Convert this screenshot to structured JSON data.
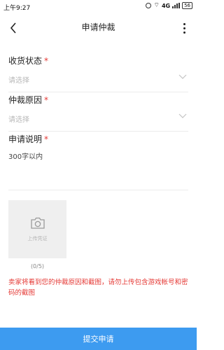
{
  "status_bar": {
    "time": "上午9:27",
    "network": "4G",
    "battery": "56"
  },
  "nav": {
    "title": "申请仲裁"
  },
  "form": {
    "goods_status": {
      "label": "收货状态",
      "required_mark": "*",
      "placeholder": "请选择"
    },
    "reason": {
      "label": "仲裁原因",
      "required_mark": "*",
      "placeholder": "请选择"
    },
    "description": {
      "label": "申请说明",
      "required_mark": "*",
      "placeholder": "300字以内"
    }
  },
  "upload": {
    "label": "上传凭证",
    "count": "(0/5)"
  },
  "notice": "卖家将看到您的仲裁原因和截图，请勿上传包含游戏帐号和密码的截图",
  "submit_label": "提交申请",
  "colors": {
    "accent": "#3d9bf0",
    "required": "#e53935",
    "notice": "#e53935",
    "placeholder": "#b8b8b8"
  }
}
